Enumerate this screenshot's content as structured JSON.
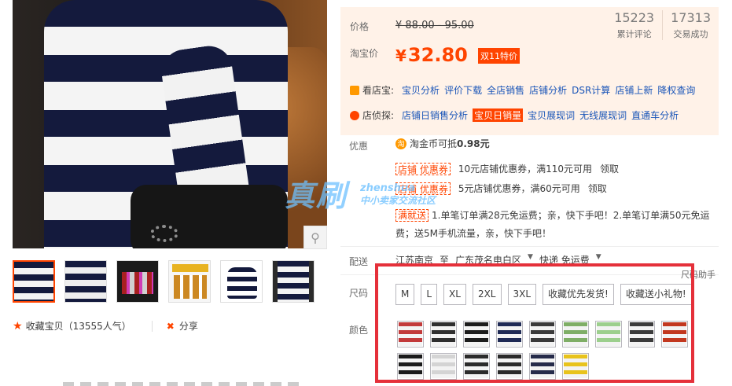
{
  "gallery": {
    "zoom_icon": "magnifier-icon",
    "favorite_label": "收藏宝贝",
    "favorite_count": "（13555人气）",
    "share_label": "分享"
  },
  "price": {
    "price_label": "价格",
    "original_price": "¥ 88.00 - 95.00",
    "taobao_label": "淘宝价",
    "currency": "¥",
    "current_price": "32.80",
    "promo_tag": "双11特价",
    "reviews_count": "15223",
    "reviews_label": "累计评论",
    "deals_count": "17313",
    "deals_label": "交易成功"
  },
  "tools": {
    "shop_tool_name": "看店宝:",
    "shop_links": [
      "宝贝分析",
      "评价下载",
      "全店销售",
      "店铺分析",
      "DSR计算",
      "店铺上新",
      "降权查询"
    ],
    "spy_tool_name": "店侦探:",
    "spy_links": [
      "店铺日销售分析",
      "宝贝日销量",
      "宝贝展现词",
      "无线展现词",
      "直通车分析"
    ]
  },
  "offers": {
    "label": "优惠",
    "coin_icon_text": "淘",
    "coin_text": "淘金币可抵",
    "coin_value": "0.98元",
    "coupon_tag": "店铺 优惠券",
    "coupon1_text": "10元店铺优惠券，满110元可用",
    "coupon2_text": "5元店铺优惠券，满60元可用",
    "get_label": "领取",
    "fullgive_tag": "满就送",
    "fullgive_text": "1.单笔订单满28元免运费；亲，快下手吧！2.单笔订单满50元免运费；送5M手机流量，亲，快下手吧！"
  },
  "shipping": {
    "label": "配送",
    "from": "江苏南京",
    "to_word": "至",
    "to": "广东茂名电白区",
    "method": "快递 免运费"
  },
  "sku": {
    "size_helper": "尺码助手",
    "size_label": "尺码",
    "sizes": [
      "M",
      "L",
      "XL",
      "2XL",
      "3XL",
      "收藏优先发货!",
      "收藏送小礼物!"
    ],
    "color_label": "颜色"
  },
  "watermark": {
    "big": "真刷",
    "url": "zhenshua",
    "sub": "中小卖家交流社区"
  },
  "colors": {
    "accent": "#ff4400",
    "link": "#1a55b8",
    "highlight_box": "#e5303a",
    "swatches": [
      "#c23a3a",
      "#2f2f2f",
      "#1c1c1c",
      "#1f2a55",
      "#3a3a3a",
      "#7fae66",
      "#9ccf8d",
      "#3b3b3b",
      "#c2381f",
      "#1a1a1a",
      "#d4d4d4",
      "#2b2b2b",
      "#2a2a2a",
      "#262b4a",
      "#e8c31c"
    ]
  }
}
